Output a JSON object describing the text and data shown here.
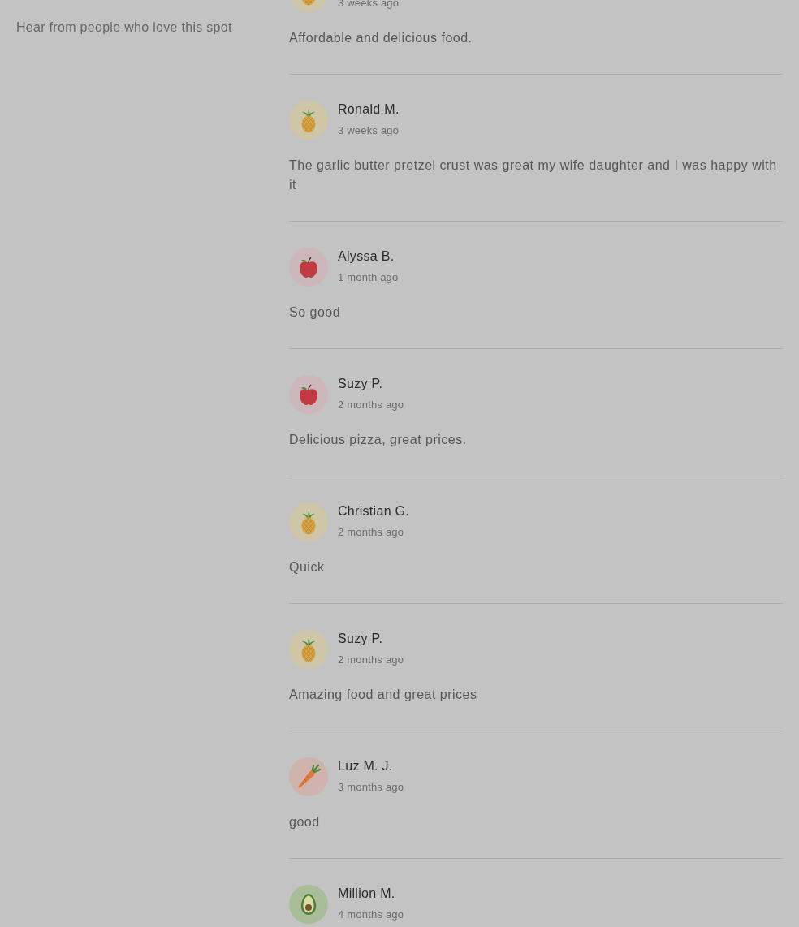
{
  "intro": {
    "subtitle": "Hear from people who love this spot"
  },
  "reviews": [
    {
      "avatar": {
        "kind": "pineapple"
      },
      "time": "3 weeks ago",
      "text": "Affordable and delicious food."
    },
    {
      "name": "Ronald M.",
      "avatar": {
        "kind": "pineapple"
      },
      "time": "3 weeks ago",
      "text": "The garlic butter pretzel crust was great my wife daughter and I was happy with it"
    },
    {
      "name": "Alyssa B.",
      "avatar": {
        "kind": "apple"
      },
      "time": "1 month ago",
      "text": "So good"
    },
    {
      "name": "Suzy P.",
      "avatar": {
        "kind": "apple"
      },
      "time": "2 months ago",
      "text": "Delicious pizza, great prices."
    },
    {
      "name": "Christian G.",
      "avatar": {
        "kind": "pineapple"
      },
      "time": "2 months ago",
      "text": "Quick"
    },
    {
      "name": "Suzy P.",
      "avatar": {
        "kind": "pineapple"
      },
      "time": "2 months ago",
      "text": "Amazing food and great prices"
    },
    {
      "name": "Luz M. J.",
      "avatar": {
        "kind": "carrot"
      },
      "time": "3 months ago",
      "text": "good"
    },
    {
      "name": "Million M.",
      "avatar": {
        "kind": "avocado"
      },
      "time": "4 months ago"
    }
  ]
}
